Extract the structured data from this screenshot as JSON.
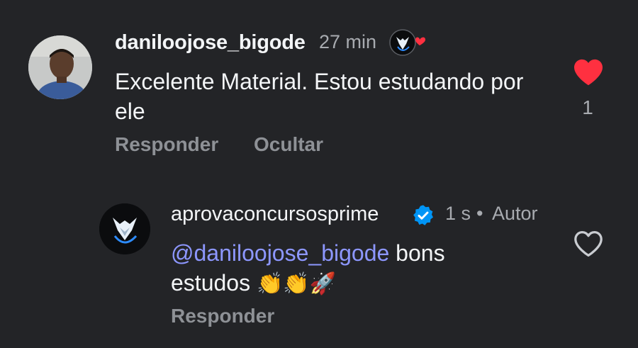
{
  "comments": [
    {
      "username": "daniloojose_bigode",
      "time": "27 min",
      "text": "Excelente Material. Estou estudando por ele",
      "reply_label": "Responder",
      "hide_label": "Ocultar",
      "likes": "1",
      "liked": true,
      "badge_icon": "wolf-logo-with-heart-icon"
    },
    {
      "username": "aprovaconcursosprime",
      "verified": true,
      "time": "1 s",
      "separator": "•",
      "author_label": "Autor",
      "mention": "@daniloojose_bigode",
      "text_after_mention": " bons",
      "text_line2": "estudos",
      "emojis": [
        "👏",
        "👏",
        "🚀"
      ],
      "reply_label": "Responder",
      "liked": false
    }
  ],
  "colors": {
    "background": "#232427",
    "text_primary": "#f3f5f7",
    "text_secondary": "#a8abb0",
    "action_text": "#8e9196",
    "mention": "#8d97ff",
    "like_red": "#ff3040",
    "verified_blue": "#0095f6"
  }
}
